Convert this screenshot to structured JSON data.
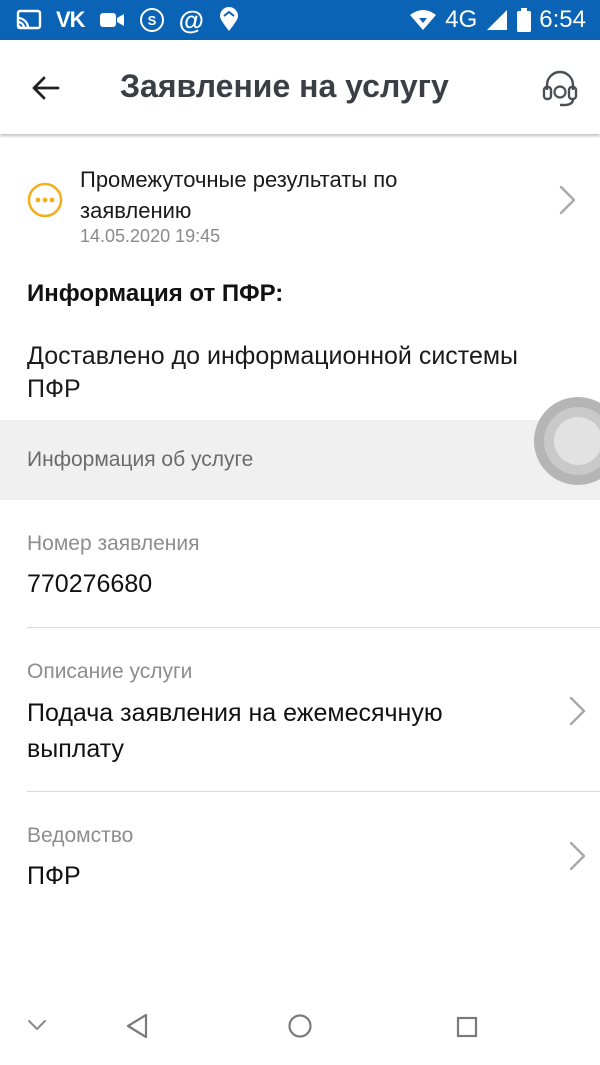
{
  "status_bar": {
    "vk_label": "VK",
    "at_label": "@",
    "network": "4G",
    "time": "6:54"
  },
  "header": {
    "title": "Заявление на услугу",
    "back_icon": "arrow-back-icon",
    "support_icon": "headset-icon"
  },
  "progress": {
    "title": "Промежуточные результаты по заявлению",
    "date": "14.05.2020 19:45",
    "status_color": "#f2b01e"
  },
  "pfr_info": {
    "heading": "Информация от ПФР:",
    "message": "Доставлено до информационной системы ПФР"
  },
  "service_info": {
    "section_title": "Информация об услуге",
    "fields": [
      {
        "label": "Номер заявления",
        "value": "770276680"
      },
      {
        "label": "Описание услуги",
        "value": "Подача заявления на ежемесячную выплату"
      },
      {
        "label": "Ведомство",
        "value": "ПФР"
      }
    ]
  },
  "colors": {
    "status_bar": "#0b63b5",
    "accent": "#f2b01e"
  }
}
